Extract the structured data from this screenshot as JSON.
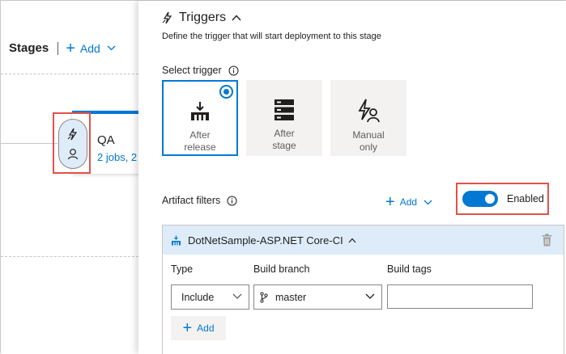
{
  "pipeline": {
    "stages_title": "Stages",
    "add_label": "Add",
    "stage": {
      "name": "QA",
      "jobs": "2 jobs, 2"
    }
  },
  "triggers": {
    "title": "Triggers",
    "description": "Define the trigger that will start deployment to this stage",
    "select_trigger_label": "Select trigger",
    "options": [
      {
        "line1": "After",
        "line2": "release",
        "selected": true,
        "icon": "release-icon"
      },
      {
        "line1": "After",
        "line2": "stage",
        "selected": false,
        "icon": "stage-icon"
      },
      {
        "line1": "Manual",
        "line2": "only",
        "selected": false,
        "icon": "manual-icon"
      }
    ]
  },
  "artifact_filters": {
    "label": "Artifact filters",
    "add_label": "Add",
    "toggle_label": "Enabled",
    "toggle_on": true,
    "artifact": {
      "name": "DotNetSample-ASP.NET Core-CI",
      "columns": {
        "type": "Type",
        "branch": "Build branch",
        "tags": "Build tags"
      },
      "row": {
        "type": "Include",
        "branch": "master",
        "tags": ""
      },
      "add_button": "Add"
    }
  },
  "colors": {
    "accent": "#0078d4",
    "highlight": "#e0534a",
    "tile_bg": "#f3f2f1",
    "header_bg": "#deecf9"
  }
}
